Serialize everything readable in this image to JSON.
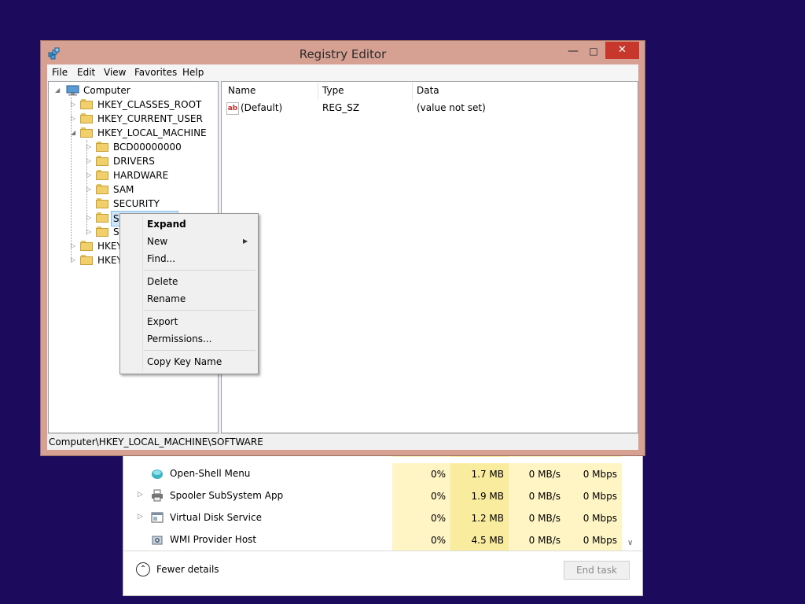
{
  "registry_editor": {
    "title": "Registry Editor",
    "menu": [
      "File",
      "Edit",
      "View",
      "Favorites",
      "Help"
    ],
    "tree": {
      "root": "Computer",
      "hives": [
        "HKEY_CLASSES_ROOT",
        "HKEY_CURRENT_USER",
        "HKEY_LOCAL_MACHINE"
      ],
      "hklm_children": [
        "BCD00000000",
        "DRIVERS",
        "HARDWARE",
        "SAM",
        "SECURITY",
        "SO",
        "SY"
      ],
      "more_hives": [
        "HKEY",
        "HKEY"
      ]
    },
    "columns": [
      "Name",
      "Type",
      "Data"
    ],
    "values": [
      {
        "name": "(Default)",
        "type": "REG_SZ",
        "data": "(value not set)",
        "icon": "string-value-icon"
      }
    ],
    "status": "Computer\\HKEY_LOCAL_MACHINE\\SOFTWARE",
    "context_menu": {
      "items": [
        "Expand",
        "New",
        "Find...",
        "Delete",
        "Rename",
        "Export",
        "Permissions...",
        "Copy Key Name"
      ],
      "default_item": "Expand"
    },
    "title_bar_color": "#d6a192"
  },
  "task_manager": {
    "rows": [
      {
        "name": "Open-Shell Menu",
        "cpu": "0%",
        "memory": "1.7 MB",
        "disk": "0 MB/s",
        "network": "0 Mbps",
        "expandable": false
      },
      {
        "name": "Spooler SubSystem App",
        "cpu": "0%",
        "memory": "1.9 MB",
        "disk": "0 MB/s",
        "network": "0 Mbps",
        "expandable": true
      },
      {
        "name": "Virtual Disk Service",
        "cpu": "0%",
        "memory": "1.2 MB",
        "disk": "0 MB/s",
        "network": "0 Mbps",
        "expandable": true
      },
      {
        "name": "WMI Provider Host",
        "cpu": "0%",
        "memory": "4.5 MB",
        "disk": "0 MB/s",
        "network": "0 Mbps",
        "expandable": false
      }
    ],
    "fewer_details": "Fewer details",
    "end_task": "End task"
  }
}
